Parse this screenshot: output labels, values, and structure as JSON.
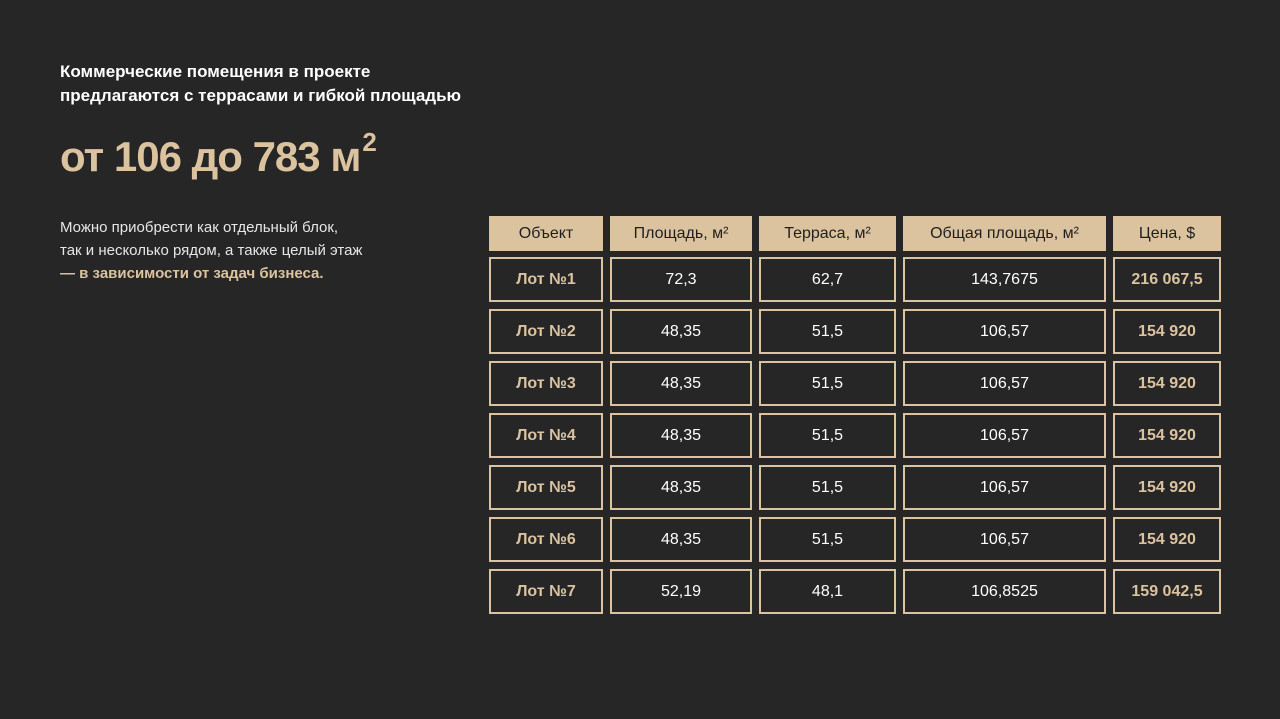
{
  "heading": {
    "line1": "Коммерческие помещения в проекте",
    "line2": "предлагаются с террасами и гибкой площадью"
  },
  "range": {
    "text": "от 106 до 783 м",
    "sup": "2"
  },
  "description": {
    "line1": "Можно приобрести как отдельный блок,",
    "line2": "так и несколько рядом, а также целый этаж",
    "dash": "— ",
    "accent": "в зависимости от задач бизнеса."
  },
  "colors": {
    "background": "#262626",
    "accent": "#dcc39f",
    "text": "#ffffff"
  },
  "table": {
    "headers": [
      "Объект",
      "Площадь, м²",
      "Терраса, м²",
      "Общая площадь, м²",
      "Цена, $"
    ],
    "rows": [
      [
        "Лот №1",
        "72,3",
        "62,7",
        "143,7675",
        "216 067,5"
      ],
      [
        "Лот №2",
        "48,35",
        "51,5",
        "106,57",
        "154 920"
      ],
      [
        "Лот №3",
        "48,35",
        "51,5",
        "106,57",
        "154 920"
      ],
      [
        "Лот №4",
        "48,35",
        "51,5",
        "106,57",
        "154 920"
      ],
      [
        "Лот №5",
        "48,35",
        "51,5",
        "106,57",
        "154 920"
      ],
      [
        "Лот №6",
        "48,35",
        "51,5",
        "106,57",
        "154 920"
      ],
      [
        "Лот №7",
        "52,19",
        "48,1",
        "106,8525",
        "159 042,5"
      ]
    ]
  }
}
